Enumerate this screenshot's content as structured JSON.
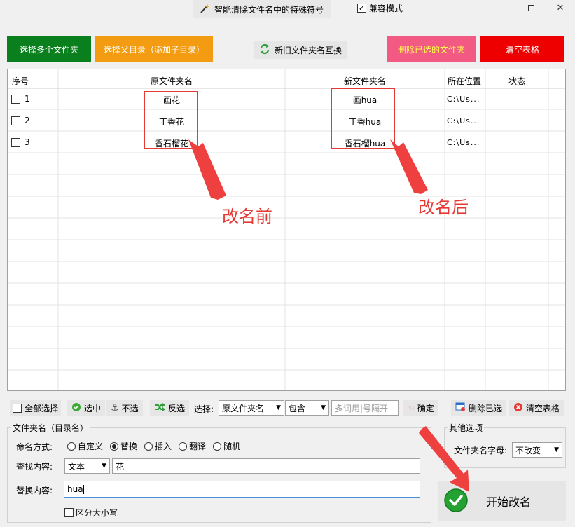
{
  "window": {
    "title": "智能清除文件名中的特殊符号",
    "compat_label": "兼容模式",
    "compat_checked": true
  },
  "top_buttons": {
    "select_folders": "选择多个文件夹",
    "select_parent": "选择父目录（添加子目录）",
    "swap_names": "新旧文件夹名互换",
    "delete_selected": "删除已选的文件夹",
    "clear_table": "清空表格"
  },
  "colors": {
    "green": "#0a7f1d",
    "orange": "#f39c12",
    "pink": "#f25a83",
    "red": "#ef0000",
    "annotation": "#e53935"
  },
  "table": {
    "columns": [
      "序号",
      "原文件夹名",
      "新文件夹名",
      "所在位置",
      "状态"
    ],
    "rows": [
      {
        "index": "1",
        "original": "画花",
        "new": "画hua",
        "location": "C:\\Us...",
        "status": ""
      },
      {
        "index": "2",
        "original": "丁香花",
        "new": "丁香hua",
        "location": "C:\\Us...",
        "status": ""
      },
      {
        "index": "3",
        "original": "香石榴花",
        "new": "香石榴hua",
        "location": "C:\\Us...",
        "status": ""
      }
    ]
  },
  "annotations": {
    "before": "改名前",
    "after": "改名后"
  },
  "toolbar": {
    "select_all": "全部选择",
    "check": "选中",
    "uncheck": "不选",
    "invert": "反选",
    "choose_label": "选择:",
    "field_select": "原文件夹名",
    "match_select": "包含",
    "keyword_placeholder": "多词用|号隔开",
    "confirm": "确定",
    "delete_selected": "删除已选",
    "clear_table": "清空表格"
  },
  "rename_panel": {
    "group_title": "文件夹名（目录名）",
    "mode_label": "命名方式:",
    "modes": [
      {
        "label": "自定义",
        "selected": false
      },
      {
        "label": "替换",
        "selected": true
      },
      {
        "label": "插入",
        "selected": false
      },
      {
        "label": "翻译",
        "selected": false
      },
      {
        "label": "随机",
        "selected": false
      }
    ],
    "find_label": "查找内容:",
    "find_type": "文本",
    "find_value": "花",
    "replace_label": "替换内容:",
    "replace_value": "hua",
    "case_label": "区分大小写"
  },
  "other_options": {
    "group_title": "其他选项",
    "case_label": "文件夹名字母:",
    "case_value": "不改变"
  },
  "start_button": "开始改名"
}
